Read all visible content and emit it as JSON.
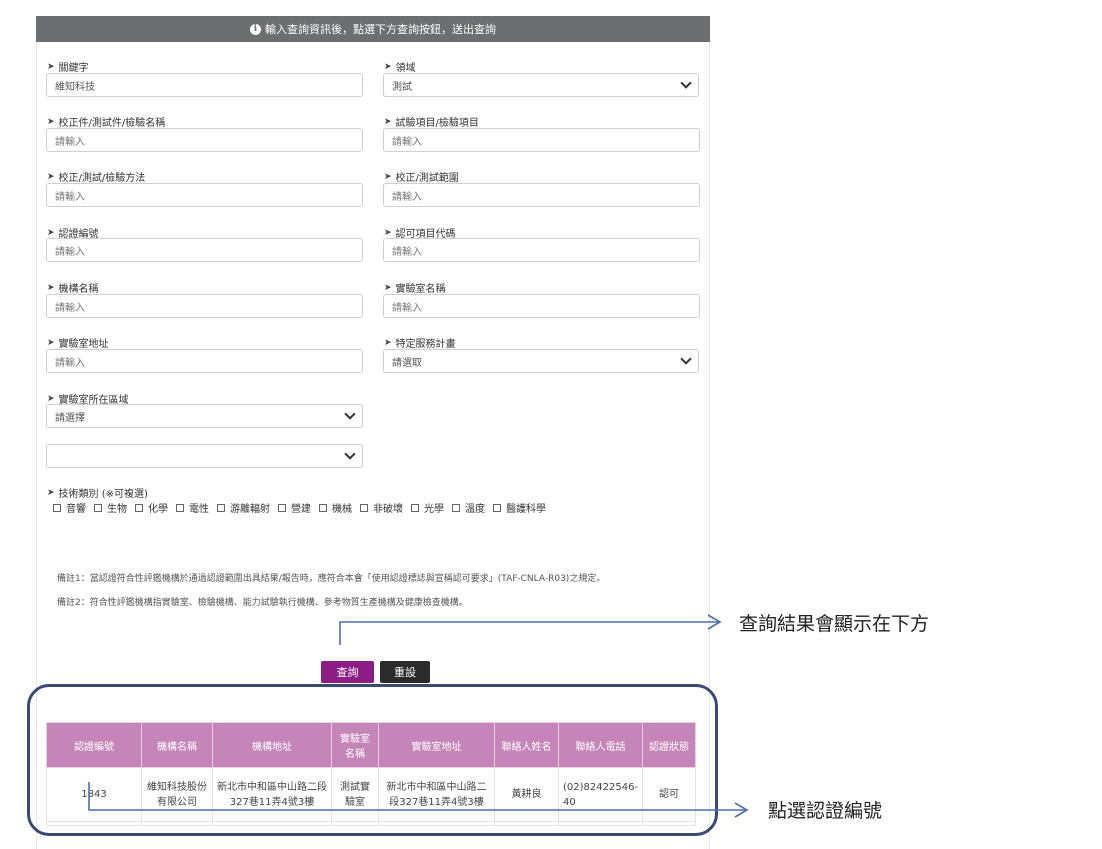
{
  "header": {
    "text": "輸入查詢資訊後，點選下方查詢按鈕，送出查詢"
  },
  "form": {
    "keyword": {
      "label": "關鍵字",
      "value": "維知科技"
    },
    "domain": {
      "label": "領域",
      "value": "測試"
    },
    "item_name": {
      "label": "校正件/測試件/檢驗名稱",
      "placeholder": "請輸入"
    },
    "test_item": {
      "label": "試驗項目/檢驗項目",
      "placeholder": "請輸入"
    },
    "method": {
      "label": "校正/測試/檢驗方法",
      "placeholder": "請輸入"
    },
    "range": {
      "label": "校正/測試範圍",
      "placeholder": "請輸入"
    },
    "cert_no": {
      "label": "認證編號",
      "placeholder": "請輸入"
    },
    "approval_code": {
      "label": "認可項目代碼",
      "placeholder": "請輸入"
    },
    "org_name": {
      "label": "機構名稱",
      "placeholder": "請輸入"
    },
    "lab_name": {
      "label": "實驗室名稱",
      "placeholder": "請輸入"
    },
    "lab_address": {
      "label": "實驗室地址",
      "placeholder": "請輸入"
    },
    "special_plan": {
      "label": "特定服務計畫",
      "value": "請選取"
    },
    "lab_region": {
      "label": "實驗室所在區域",
      "value": "請選擇"
    },
    "sub_region": {
      "value": ""
    },
    "tech_category": {
      "label": "技術類別 (※可複選)",
      "options": [
        "音響",
        "生物",
        "化學",
        "電性",
        "游離輻射",
        "營建",
        "機械",
        "非破壞",
        "光學",
        "溫度",
        "醫護科學"
      ]
    }
  },
  "notes": {
    "note1": "備註1：當認證符合性評鑑機構於通過認證範圍出具結果/報告時，應符合本會「使用認證標誌與宣稱認可要求」(TAF-CNLA-R03)之規定。",
    "note2": "備註2：符合性評鑑機構指實驗室、檢驗機構、能力試驗執行機構、參考物質生產機構及健康檢查機構。"
  },
  "buttons": {
    "query": "查詢",
    "reset": "重設"
  },
  "results": {
    "headers": [
      "認證編號",
      "機構名稱",
      "機構地址",
      "實驗室名稱",
      "實驗室地址",
      "聯絡人姓名",
      "聯絡人電話",
      "認證狀態"
    ],
    "rows": [
      {
        "cert_no": "1843",
        "org_name": "維知科技股份有限公司",
        "org_address": "新北市中和區中山路二段327巷11弄4號3樓",
        "lab_name": "測試實驗室",
        "lab_address": "新北市中和區中山路二段327巷11弄4號3樓",
        "contact_name": "黃耕良",
        "contact_phone": "(02)82422546-40",
        "status": "認可"
      }
    ]
  },
  "annotations": {
    "results_below": "查詢結果會顯示在下方",
    "click_cert": "點選認證編號"
  },
  "colors": {
    "header_bg": "#6d6e70",
    "query_button": "#8e1c85",
    "reset_button": "#2b2b2b",
    "table_header": "#c585b9",
    "annotation_line": "#4a70b0",
    "outline": "#3a4a72"
  }
}
